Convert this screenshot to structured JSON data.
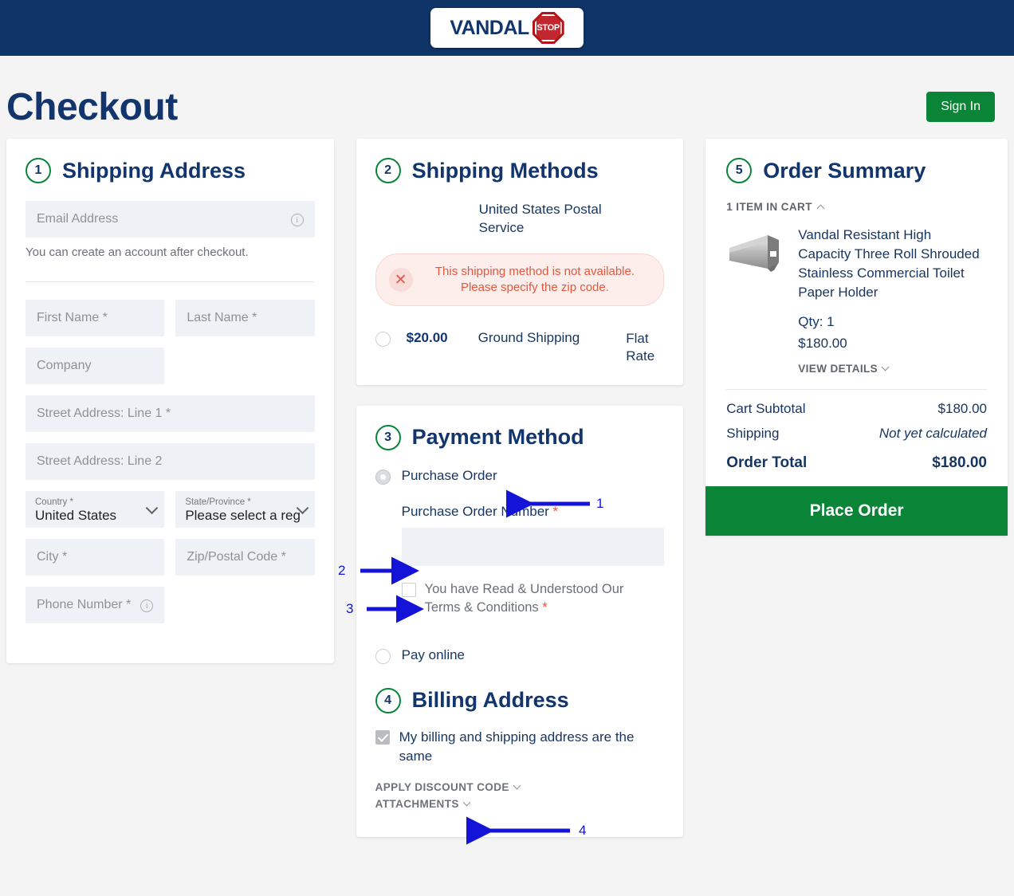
{
  "brand": {
    "word": "VANDAL",
    "sign_text": "STOP",
    "navy": "#0f3468",
    "red": "#b41419"
  },
  "header": {
    "title": "Checkout",
    "sign_in_label": "Sign In",
    "accent_green": "#0a8537"
  },
  "shipping_address": {
    "step": "1",
    "title": "Shipping Address",
    "email_placeholder": "Email Address",
    "helper": "You can create an account after checkout.",
    "first_name_placeholder": "First Name *",
    "last_name_placeholder": "Last Name *",
    "company_placeholder": "Company",
    "street1_placeholder": "Street Address: Line 1 *",
    "street2_placeholder": "Street Address: Line 2",
    "country_label": "Country *",
    "country_value": "United States",
    "state_label": "State/Province *",
    "state_value": "Please select a reg",
    "city_placeholder": "City *",
    "zip_placeholder": "Zip/Postal Code *",
    "phone_placeholder": "Phone Number *"
  },
  "shipping_methods": {
    "step": "2",
    "title": "Shipping Methods",
    "carrier": "United States Postal Service",
    "error_line1": "This shipping method is not available.",
    "error_line2": "Please specify the zip code.",
    "error_color": "#e2583f",
    "method_price": "$20.00",
    "method_name": "Ground Shipping",
    "method_type": "Flat Rate"
  },
  "payment": {
    "step": "3",
    "title": "Payment Method",
    "option_purchase_order": "Purchase Order",
    "po_number_label": "Purchase Order Number",
    "po_number_value": "",
    "terms_text": "You have Read & Understood Our Terms & Conditions",
    "option_pay_online": "Pay online",
    "required_mark": "*"
  },
  "billing": {
    "step": "4",
    "title": "Billing Address",
    "same_as_shipping": "My billing and shipping address are the same",
    "apply_discount": "APPLY DISCOUNT CODE",
    "attachments": "ATTACHMENTS"
  },
  "order_summary": {
    "step": "5",
    "title": "Order Summary",
    "cart_count": "1 ITEM IN CART",
    "product_name": "Vandal Resistant High Capacity Three Roll Shrouded Stainless Commercial Toilet Paper Holder",
    "qty": "Qty: 1",
    "price": "$180.00",
    "view_details": "VIEW DETAILS",
    "subtotal_label": "Cart Subtotal",
    "subtotal_value": "$180.00",
    "shipping_label": "Shipping",
    "shipping_value": "Not yet calculated",
    "total_label": "Order Total",
    "total_value": "$180.00",
    "place_order_label": "Place Order"
  },
  "annotations": {
    "color": "#1414d8",
    "items": [
      {
        "id": "1",
        "label": "1"
      },
      {
        "id": "2",
        "label": "2"
      },
      {
        "id": "3",
        "label": "3"
      },
      {
        "id": "4",
        "label": "4"
      }
    ]
  }
}
